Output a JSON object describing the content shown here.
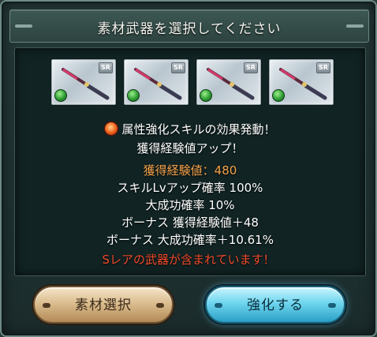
{
  "dialog": {
    "title": "素材武器を選択してください"
  },
  "weapons": [
    {
      "rarity": "SR",
      "element": "wind",
      "icon": "spear-icon"
    },
    {
      "rarity": "SR",
      "element": "wind",
      "icon": "spear-icon"
    },
    {
      "rarity": "SR",
      "element": "wind",
      "icon": "spear-icon"
    },
    {
      "rarity": "SR",
      "element": "wind",
      "icon": "spear-icon"
    }
  ],
  "effect": {
    "icon": "fire-element-icon",
    "line1": "属性強化スキルの効果発動！",
    "line2": "獲得経験値アップ！"
  },
  "stats": {
    "exp": "獲得経験値：480",
    "skill_lv_rate": "スキルLvアップ確率 100%",
    "great_success_rate": "大成功確率 10%",
    "bonus_exp": "ボーナス 獲得経験値＋48",
    "bonus_great_success": "ボーナス 大成功確率＋10.61%"
  },
  "warning": "Sレアの武器が含まれています！",
  "buttons": {
    "material_select": "素材選択",
    "enhance": "強化する"
  },
  "colors": {
    "exp_highlight": "#f4a24a",
    "warning": "#f04a2a",
    "enhance_button": "#6fd6ee",
    "material_button": "#d8b98a"
  }
}
